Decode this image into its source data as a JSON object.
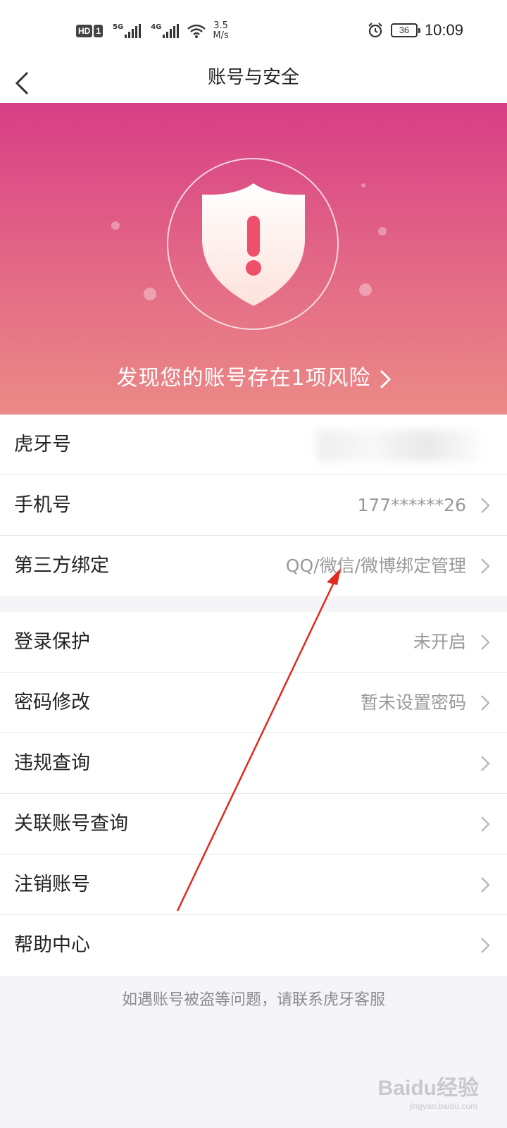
{
  "status_bar": {
    "hd_label": "HD",
    "sim_label": "1",
    "net1_label": "5G",
    "net2_label": "4G",
    "speed_value": "3.5",
    "speed_unit": "M/s",
    "battery_level": "36",
    "time": "10:09"
  },
  "nav": {
    "title": "账号与安全",
    "back_icon": "chevron-left-icon"
  },
  "banner": {
    "risk_text": "发现您的账号存在1项风险",
    "shield_icon": "shield-alert-icon",
    "colors": {
      "top": "#d83e85",
      "bottom": "#eb8a86"
    }
  },
  "account_rows": [
    {
      "label": "虎牙号",
      "value": ""
    },
    {
      "label": "手机号",
      "value": "177******26"
    },
    {
      "label": "第三方绑定",
      "value": "QQ/微信/微博绑定管理"
    }
  ],
  "security_rows": [
    {
      "label": "登录保护",
      "value": "未开启"
    },
    {
      "label": "密码修改",
      "value": "暂未设置密码"
    },
    {
      "label": "违规查询",
      "value": ""
    },
    {
      "label": "关联账号查询",
      "value": ""
    },
    {
      "label": "注销账号",
      "value": ""
    },
    {
      "label": "帮助中心",
      "value": ""
    }
  ],
  "footer": {
    "note": "如遇账号被盗等问题，请联系虎牙客服"
  },
  "watermark": {
    "text": "Baidu经验",
    "sub": "jingyan.baidu.com"
  },
  "annotation": {
    "color": "#e02a20",
    "icon": "red-arrow-annotation"
  }
}
